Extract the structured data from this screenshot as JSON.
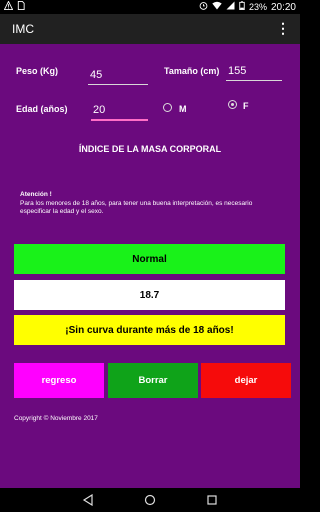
{
  "status_bar": {
    "left_icons": [
      "warning-icon",
      "sim-icon"
    ],
    "right_icons": [
      "alarm-icon",
      "wifi-icon",
      "signal-icon"
    ],
    "battery": "23%",
    "time": "20:20"
  },
  "app_bar": {
    "title": "IMC",
    "menu_icon": "overflow-menu-icon"
  },
  "form": {
    "weight_label": "Peso (Kg)",
    "weight_value": "45",
    "height_label": "Tamaño (cm)",
    "height_value": "155",
    "age_label": "Edad (años)",
    "age_value": "20",
    "sex_options": [
      {
        "label": "M",
        "checked": false
      },
      {
        "label": "F",
        "checked": true
      }
    ]
  },
  "section_title": "ÍNDICE DE LA MASA CORPORAL",
  "notice": {
    "title": "Atención !",
    "text": " Para los menores de 18 años, para tener una buena interpretación, es necesario especificar la edad y el sexo."
  },
  "results": {
    "status": "Normal",
    "value": "18.7",
    "warning": "¡Sin curva durante más de 18 años!"
  },
  "colors": {
    "background": "#6b0a7e",
    "status_green": "#19f219",
    "warning_yellow": "#ffff00",
    "back_magenta": "#ff00ff",
    "clear_green": "#0fa319",
    "exit_red": "#f60b0b"
  },
  "buttons": {
    "back": "regreso",
    "clear": "Borrar",
    "exit": "dejar"
  },
  "copyright": "Copyright © Noviembre 2017"
}
